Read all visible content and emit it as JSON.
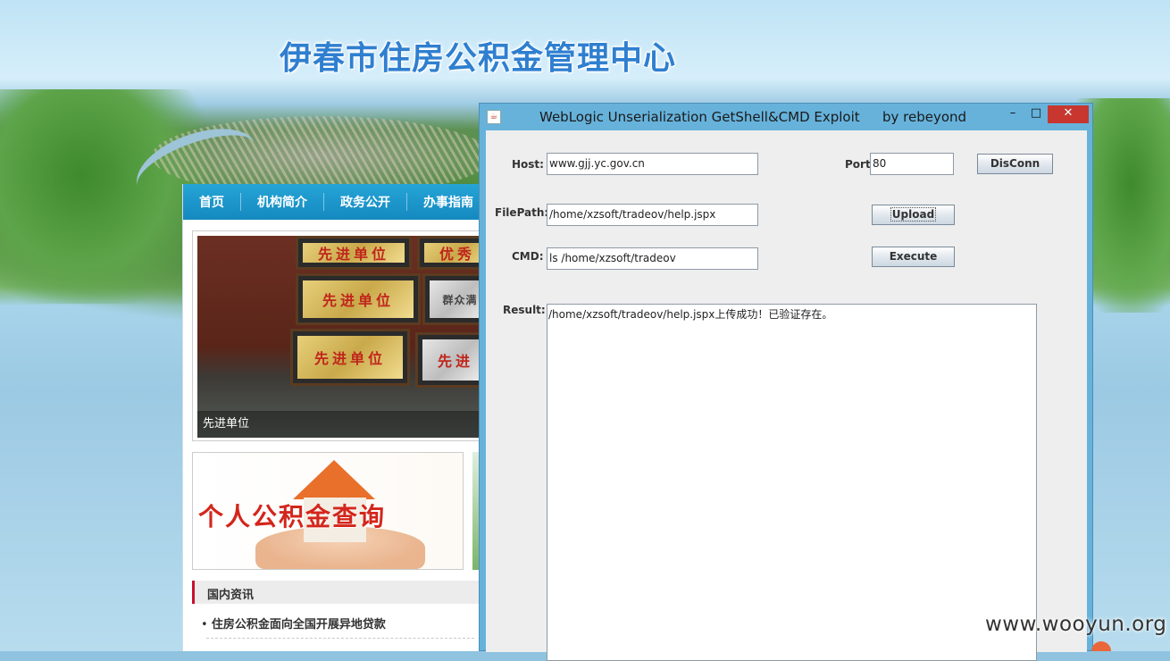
{
  "site": {
    "title": "伊春市住房公积金管理中心",
    "nav": [
      "首页",
      "机构简介",
      "政务公开",
      "办事指南"
    ],
    "banner_caption": "先进单位",
    "plaques": [
      "先进单位",
      "优秀",
      "先进单位",
      "群众满",
      "先进单位",
      "先进"
    ],
    "ad_text": "个人公积金查询",
    "news": {
      "heading": "国内资讯",
      "items": [
        "住房公积金面向全国开展异地贷款"
      ]
    }
  },
  "window": {
    "title": "WebLogic Unserialization GetShell&CMD Exploit",
    "author": "by rebeyond",
    "controls": {
      "minimize": "–",
      "maximize": "□",
      "close": "✕"
    },
    "form": {
      "host_label": "Host:",
      "host_value": "www.gjj.yc.gov.cn",
      "port_label": "Port:",
      "port_value": "80",
      "disconn_label": "DisConn",
      "filepath_label": "FilePath:",
      "filepath_value": "/home/xzsoft/tradeov/help.jspx",
      "upload_label": "Upload",
      "cmd_label": "CMD:",
      "cmd_value": "ls /home/xzsoft/tradeov",
      "execute_label": "Execute",
      "result_label": "Result:",
      "result_value": "/home/xzsoft/tradeov/help.jspx上传成功！已验证存在。"
    }
  },
  "watermark": "www.wooyun.org",
  "colors": {
    "title_blue": "#2f7fd0",
    "nav_blue": "#1489c0",
    "window_frame": "#66b2db",
    "close_red": "#c7372f",
    "news_accent": "#c8102e"
  },
  "icons": [
    "java-app-icon",
    "minimize-icon",
    "maximize-icon",
    "close-icon"
  ]
}
